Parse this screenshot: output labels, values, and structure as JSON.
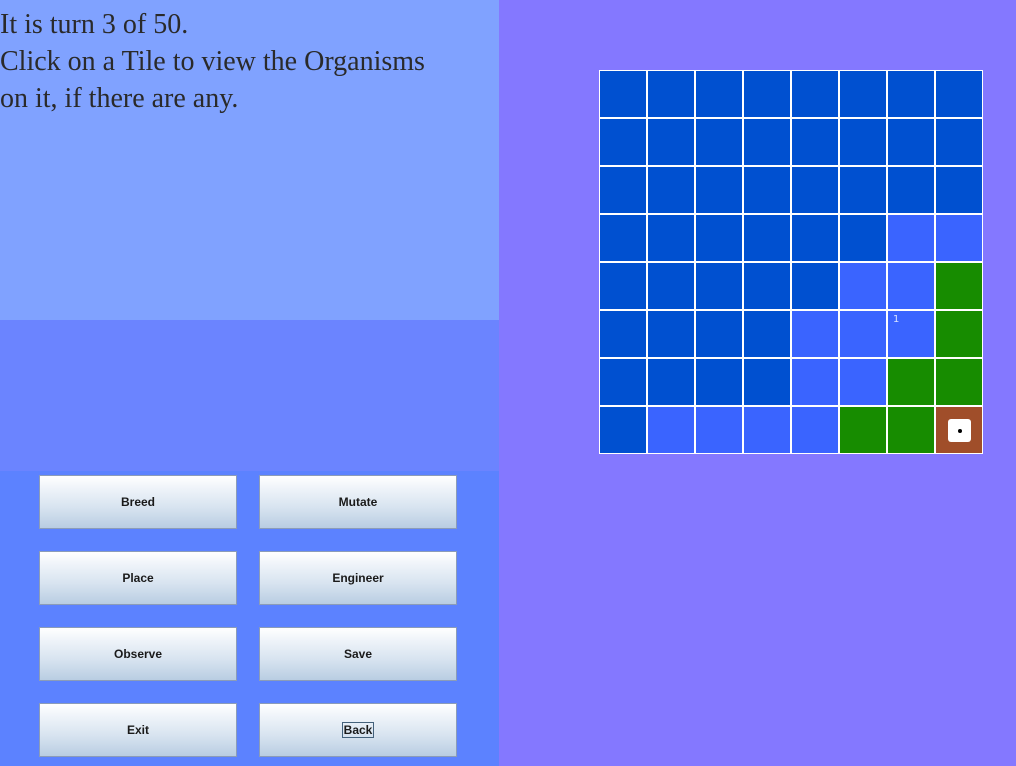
{
  "info": {
    "message": "It is turn 3 of 50.\nClick on a Tile to view the Organisms\non it, if there are any."
  },
  "buttons": [
    {
      "id": "breed",
      "label": "Breed",
      "focused": false
    },
    {
      "id": "mutate",
      "label": "Mutate",
      "focused": false
    },
    {
      "id": "place",
      "label": "Place",
      "focused": false
    },
    {
      "id": "engineer",
      "label": "Engineer",
      "focused": false
    },
    {
      "id": "observe",
      "label": "Observe",
      "focused": false
    },
    {
      "id": "save",
      "label": "Save",
      "focused": false
    },
    {
      "id": "exit",
      "label": "Exit",
      "focused": false
    },
    {
      "id": "back",
      "label": "Back",
      "focused": true
    }
  ],
  "colors": {
    "deep_water": "#0050d0",
    "shallow_water": "#3a64ff",
    "grass": "#178c00",
    "dirt": "#a04e2a"
  },
  "grid": {
    "rows": 8,
    "cols": 8,
    "tiles": [
      [
        "deep_water",
        "deep_water",
        "deep_water",
        "deep_water",
        "deep_water",
        "deep_water",
        "deep_water",
        "deep_water"
      ],
      [
        "deep_water",
        "deep_water",
        "deep_water",
        "deep_water",
        "deep_water",
        "deep_water",
        "deep_water",
        "deep_water"
      ],
      [
        "deep_water",
        "deep_water",
        "deep_water",
        "deep_water",
        "deep_water",
        "deep_water",
        "deep_water",
        "deep_water"
      ],
      [
        "deep_water",
        "deep_water",
        "deep_water",
        "deep_water",
        "deep_water",
        "deep_water",
        "shallow_water",
        "shallow_water"
      ],
      [
        "deep_water",
        "deep_water",
        "deep_water",
        "deep_water",
        "deep_water",
        "shallow_water",
        "shallow_water",
        "grass"
      ],
      [
        "deep_water",
        "deep_water",
        "deep_water",
        "deep_water",
        "shallow_water",
        "shallow_water",
        "shallow_water",
        "grass"
      ],
      [
        "deep_water",
        "deep_water",
        "deep_water",
        "deep_water",
        "shallow_water",
        "shallow_water",
        "grass",
        "grass"
      ],
      [
        "deep_water",
        "shallow_water",
        "shallow_water",
        "shallow_water",
        "shallow_water",
        "grass",
        "grass",
        "dirt"
      ]
    ],
    "organism_counts": [
      {
        "row": 5,
        "col": 6,
        "count": "1"
      }
    ],
    "player_marker": {
      "row": 7,
      "col": 7,
      "icon": "player-marker-icon"
    }
  }
}
